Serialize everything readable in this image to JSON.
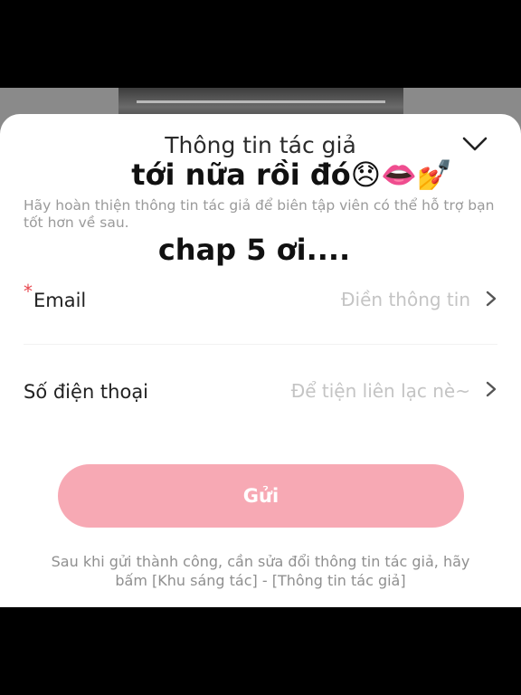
{
  "sheet": {
    "title": "Thông tin tác giả",
    "description": "Hãy hoàn thiện thông tin tác giả để biên tập viên có thể hỗ trợ bạn tốt hơn về sau.",
    "close_icon": "chevron-down-icon"
  },
  "overlay_text": {
    "line1": "tới nữa rồi đó😞👄💅",
    "line2": "chap 5 ơi...."
  },
  "form": {
    "email": {
      "required_mark": "*",
      "label": "Email",
      "placeholder": "Điền thông tin",
      "icon": "chevron-right-icon"
    },
    "phone": {
      "label": "Số điện thoại",
      "placeholder": "Để tiện liên lạc nè~",
      "icon": "chevron-right-icon"
    }
  },
  "submit": {
    "label": "Gửi",
    "color": "#f7a9b4"
  },
  "footnote": "Sau khi gửi thành công, cần sửa đổi thông tin tác giả, hãy bấm [Khu sáng tác] - [Thông tin tác giả]",
  "colors": {
    "required": "#e8474f",
    "placeholder": "#c4c4c4",
    "muted": "#9a9a9a"
  }
}
